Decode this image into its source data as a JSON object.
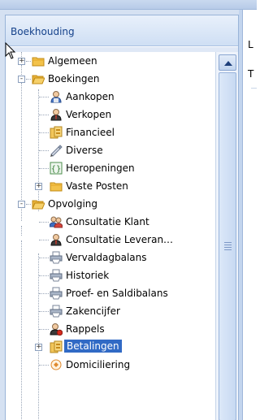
{
  "panel": {
    "title": "Boekhouding"
  },
  "right_pane": {
    "label_top": "L",
    "label_second": "T"
  },
  "tree": [
    {
      "label": "Algemeen",
      "icon": "folder-icon",
      "expander": "+"
    },
    {
      "label": "Boekingen",
      "icon": "folder-open-icon",
      "expander": "-"
    },
    {
      "label": "Aankopen",
      "icon": "user-blue-icon"
    },
    {
      "label": "Verkopen",
      "icon": "user-dark-icon"
    },
    {
      "label": "Financieel",
      "icon": "bank-icon"
    },
    {
      "label": "Diverse",
      "icon": "pen-icon"
    },
    {
      "label": "Heropeningen",
      "icon": "brackets-icon"
    },
    {
      "label": "Vaste Posten",
      "icon": "folder-icon",
      "expander": "+"
    },
    {
      "label": "Opvolging",
      "icon": "folder-open-icon",
      "expander": "-"
    },
    {
      "label": "Consultatie Klant",
      "icon": "users-icon"
    },
    {
      "label": "Consultatie Leveran…",
      "icon": "user-dark-icon"
    },
    {
      "label": "Vervaldagbalans",
      "icon": "printer-icon"
    },
    {
      "label": "Historiek",
      "icon": "printer-icon"
    },
    {
      "label": "Proef- en Saldibalans",
      "icon": "printer-icon"
    },
    {
      "label": "Zakencijfer",
      "icon": "printer-icon"
    },
    {
      "label": "Rappels",
      "icon": "user-alert-icon"
    },
    {
      "label": "Betalingen",
      "icon": "bank-icon",
      "expander": "+",
      "selected": true
    },
    {
      "label": "Domiciliering",
      "icon": "domicile-icon"
    }
  ],
  "colors": {
    "accent": "#316ac5",
    "header_text": "#15428b",
    "border": "#99b4d8"
  }
}
